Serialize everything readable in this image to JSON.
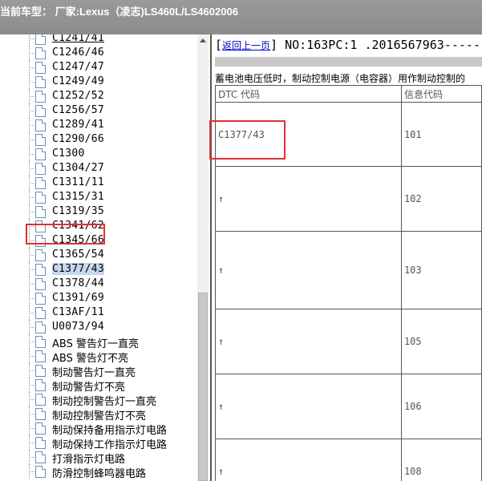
{
  "titlebar": {
    "text": "当前车型：  厂家:Lexus（凌志)LS460L/LS4602006"
  },
  "tree": {
    "items": [
      {
        "label": "C1241/41",
        "link": true
      },
      {
        "label": "C1246/46"
      },
      {
        "label": "C1247/47"
      },
      {
        "label": "C1249/49"
      },
      {
        "label": "C1252/52"
      },
      {
        "label": "C1256/57"
      },
      {
        "label": "C1289/41"
      },
      {
        "label": "C1290/66"
      },
      {
        "label": "C1300"
      },
      {
        "label": "C1304/27"
      },
      {
        "label": "C1311/11"
      },
      {
        "label": "C1315/31"
      },
      {
        "label": "C1319/35"
      },
      {
        "label": "C1341/62"
      },
      {
        "label": "C1345/66"
      },
      {
        "label": "C1365/54"
      },
      {
        "label": "C1377/43",
        "selected": true
      },
      {
        "label": "C1378/44"
      },
      {
        "label": "C1391/69"
      },
      {
        "label": "C13AF/11"
      },
      {
        "label": "U0073/94"
      },
      {
        "label": "ABS 警告灯一直亮",
        "cn": true
      },
      {
        "label": "ABS 警告灯不亮",
        "cn": true
      },
      {
        "label": "制动警告灯一直亮",
        "cn": true
      },
      {
        "label": "制动警告灯不亮",
        "cn": true
      },
      {
        "label": "制动控制警告灯一直亮",
        "cn": true
      },
      {
        "label": "制动控制警告灯不亮",
        "cn": true
      },
      {
        "label": "制动保持备用指示灯电路",
        "cn": true
      },
      {
        "label": "制动保持工作指示灯电路",
        "cn": true
      },
      {
        "label": "打滑指示灯电路",
        "cn": true
      },
      {
        "label": "防滑控制蜂鸣器电路",
        "cn": true
      }
    ]
  },
  "content": {
    "back_link": "返回上一页",
    "doc_no": "NO:163PC:1 .2016567963-----",
    "description": "蓄电池电压低时，制动控制电源（电容器）用作制动控制的",
    "table": {
      "headers": [
        "DTC 代码",
        "信息代码"
      ],
      "rows": [
        {
          "dtc": "C1377/43",
          "info": "101"
        },
        {
          "dtc": "↑",
          "info": "102"
        },
        {
          "dtc": "↑",
          "info": "103"
        },
        {
          "dtc": "↑",
          "info": "105"
        },
        {
          "dtc": "↑",
          "info": "106"
        },
        {
          "dtc": "↑",
          "info": "108"
        }
      ]
    }
  }
}
